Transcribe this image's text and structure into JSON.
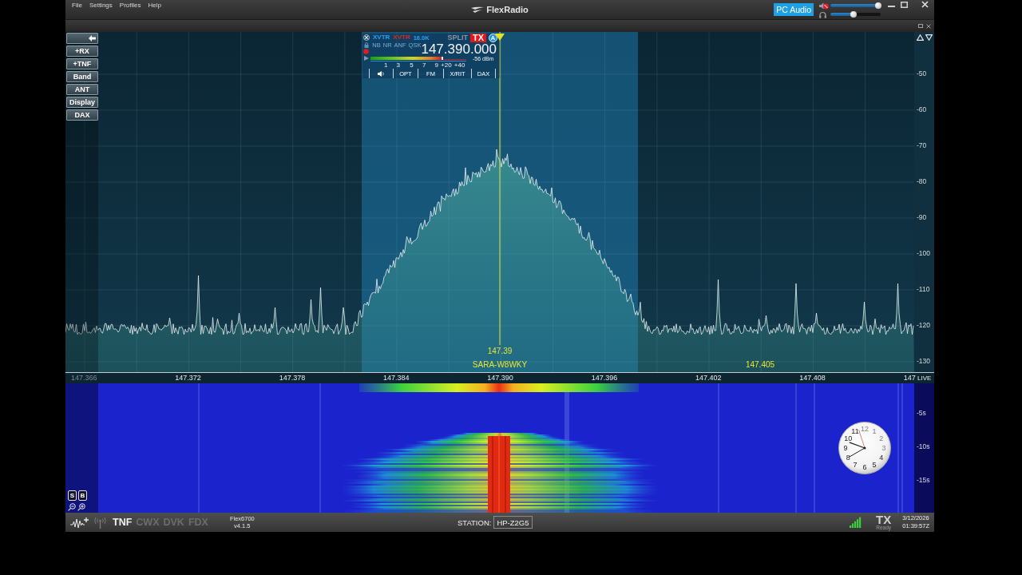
{
  "window": {
    "menu": [
      "File",
      "Settings",
      "Profiles",
      "Help"
    ],
    "logo": "FlexRadio",
    "pc_audio": {
      "label": "PC Audio",
      "on": true
    },
    "speaker_volume": {
      "muted": true,
      "level": 0.95
    },
    "headphone_volume": {
      "level": 0.46
    }
  },
  "panadapter": {
    "side_buttons": [
      "+RX",
      "+TNF",
      "Band",
      "ANT",
      "Display",
      "DAX"
    ],
    "db_scale": [
      "-50",
      "-60",
      "-70",
      "-80",
      "-90",
      "-100",
      "-110",
      "-120",
      "-130"
    ],
    "slice": {
      "antennas": [
        {
          "label": "XVTR",
          "kind": "rx"
        },
        {
          "label": "XVTR",
          "kind": "tx"
        }
      ],
      "filter_width": "16.0K",
      "split": "SPLIT",
      "tx": {
        "label": "TX",
        "on": true
      },
      "letter": "A",
      "dsp": [
        {
          "label": "NB",
          "on": false
        },
        {
          "label": "NR",
          "on": false
        },
        {
          "label": "ANF",
          "on": false
        },
        {
          "label": "QSK",
          "on": false
        }
      ],
      "frequency": "147.390.000",
      "signal": "-56 dBm",
      "meter": {
        "level": 0.74
      },
      "meter_scale": [
        "1",
        "3",
        "5",
        "7",
        "9",
        "+20",
        "+40"
      ],
      "buttons": [
        "OPT",
        "FM",
        "X/RIT",
        "DAX"
      ]
    },
    "spots": [
      "147.39",
      "SARA-W8WKY",
      "147.405"
    ],
    "frequency_scale": [
      {
        "label": "147.366",
        "dimmed": true
      },
      {
        "label": "147.372",
        "dimmed": false
      },
      {
        "label": "147.378",
        "dimmed": false
      },
      {
        "label": "147.384",
        "dimmed": false
      },
      {
        "label": "147.390",
        "dimmed": false
      },
      {
        "label": "147.396",
        "dimmed": false
      },
      {
        "label": "147.402",
        "dimmed": false
      },
      {
        "label": "147.408",
        "dimmed": false
      },
      {
        "label": "147",
        "dimmed": false
      }
    ],
    "live": "LIVE"
  },
  "waterfall": {
    "buttons": [
      "S",
      "B"
    ],
    "time_scale": [
      "-5s",
      "-10s",
      "-15s"
    ],
    "clock": [
      "11",
      "12",
      "1",
      "10",
      "2",
      "9",
      "3",
      "8",
      "4",
      "7",
      "6",
      "5"
    ]
  },
  "status_bar": {
    "toggles": [
      {
        "label": "TNF",
        "on": true
      },
      {
        "label": "CWX",
        "on": false
      },
      {
        "label": "DVK",
        "on": false
      },
      {
        "label": "FDX",
        "on": false
      }
    ],
    "model": "Flex6700",
    "version": "v4.1.5",
    "station_label": "STATION:",
    "station": "HP-Z2G5",
    "tx": "TX",
    "tx_status": "Ready",
    "date": "3/12/2026",
    "time": "01:39:57Z"
  }
}
